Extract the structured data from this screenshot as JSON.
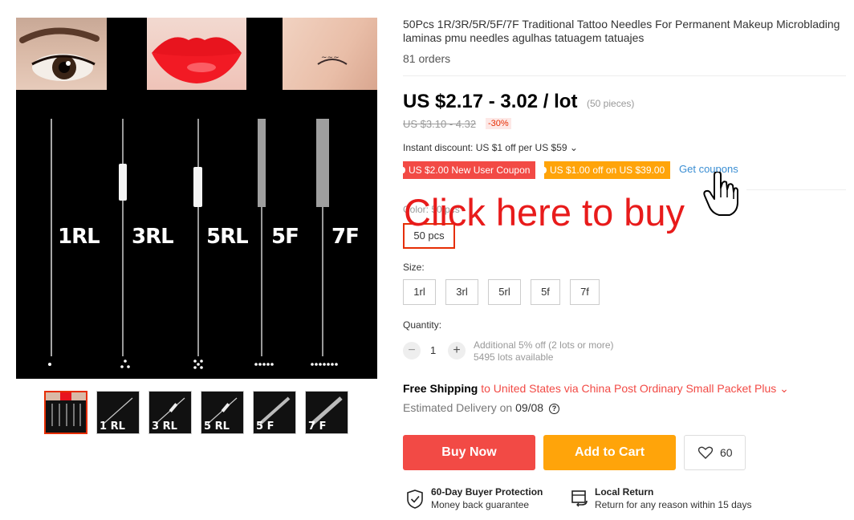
{
  "product": {
    "title": "50Pcs 1R/3R/5R/5F/7F Traditional Tattoo Needles For Permanent Makeup Microblading laminas pmu needles agulhas tatuagem tatuajes",
    "orders": "81 orders",
    "price": "US $2.17 - 3.02 / lot",
    "price_unit": "(50 pieces)",
    "old_price": "US $3.10 - 4.32",
    "discount": "-30%",
    "instant_discount": "Instant discount: US $1 off per US $59 ⌄",
    "coupons": [
      "US $2.00 New User Coupon",
      "US $1.00 off on US $39.00"
    ],
    "get_coupons": "Get coupons",
    "overlay": "Click here to buy",
    "color_label": "Color: 50 pcs",
    "color_options": [
      "50 pcs"
    ],
    "size_label": "Size:",
    "size_options": [
      "1rl",
      "3rl",
      "5rl",
      "5f",
      "7f"
    ],
    "quantity_label": "Quantity:",
    "quantity_value": "1",
    "qty_minus": "−",
    "qty_plus": "+",
    "qty_note_1": "Additional 5% off (2 lots or more)",
    "qty_note_2": "5495 lots available",
    "shipping_strong": "Free Shipping",
    "shipping_via": " to United States via China Post Ordinary Small Packet Plus ⌄",
    "estimated_prefix": "Estimated Delivery on ",
    "estimated_date": "09/08",
    "help_glyph": "?",
    "buy_now": "Buy Now",
    "add_to_cart": "Add to Cart",
    "wishlist_count": "60",
    "protection_title": "60-Day Buyer Protection",
    "protection_sub": "Money back guarantee",
    "return_title": "Local Return",
    "return_sub": "Return for any reason within 15 days"
  },
  "gallery": {
    "main_labels": [
      "1RL",
      "3RL",
      "5RL",
      "5F",
      "7F"
    ],
    "thumb_labels": [
      "",
      "1 RL",
      "3 RL",
      "5 RL",
      "5 F",
      "7 F"
    ]
  },
  "colors": {
    "accent_red": "#f24a45",
    "accent_orange": "#ffa40a",
    "link_blue": "#3a8ed3",
    "overlay_red": "#e81b1b"
  },
  "icons": [
    "shield-check-icon",
    "return-box-icon",
    "heart-icon",
    "question-icon",
    "hand-pointer-icon"
  ]
}
